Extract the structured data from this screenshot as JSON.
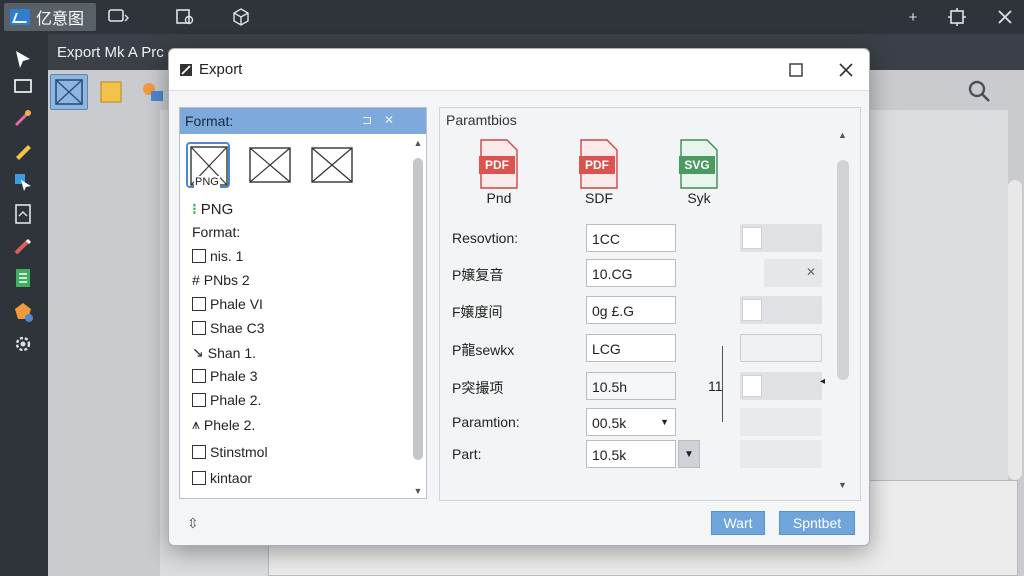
{
  "app": {
    "name": "亿意图"
  },
  "document": {
    "title": "Export Mk A Prc"
  },
  "dialog": {
    "title": "Export",
    "left_panel": {
      "header": "Format:",
      "thumb_tag": "PNG",
      "selected_name": "PNG",
      "section_label": "Format:",
      "items": [
        "nis.  1",
        "PNbs 2",
        "Phale VI",
        "Shae C3",
        "Shan 1.",
        "Phale 3",
        "Phale 2.",
        "Phele 2.",
        "Stinstmol",
        "kintaor"
      ]
    },
    "right_panel": {
      "title": "Paramtbios",
      "formats": [
        {
          "badge": "PDF",
          "label": "Pnd",
          "color": "#d9534f"
        },
        {
          "badge": "PDF",
          "label": "SDF",
          "color": "#d9534f"
        },
        {
          "badge": "SVG",
          "label": "Syk",
          "color": "#4a9a62"
        }
      ],
      "rows": [
        {
          "label": "Resovtion:",
          "value": "1CC"
        },
        {
          "label": "P嬢复音",
          "value": "10.CG"
        },
        {
          "label": "F嬢度间",
          "value": "0g £.G"
        },
        {
          "label": "P龍sewkx",
          "value": "LCG"
        },
        {
          "label": "P突撮项",
          "value": "10.5h"
        },
        {
          "label": "Paramtion:",
          "value": "00.5k"
        },
        {
          "label": "Part:",
          "value": "10.5k"
        }
      ],
      "side_number": "11"
    },
    "buttons": {
      "wait": "Wart",
      "submit": "Spntbet"
    }
  }
}
